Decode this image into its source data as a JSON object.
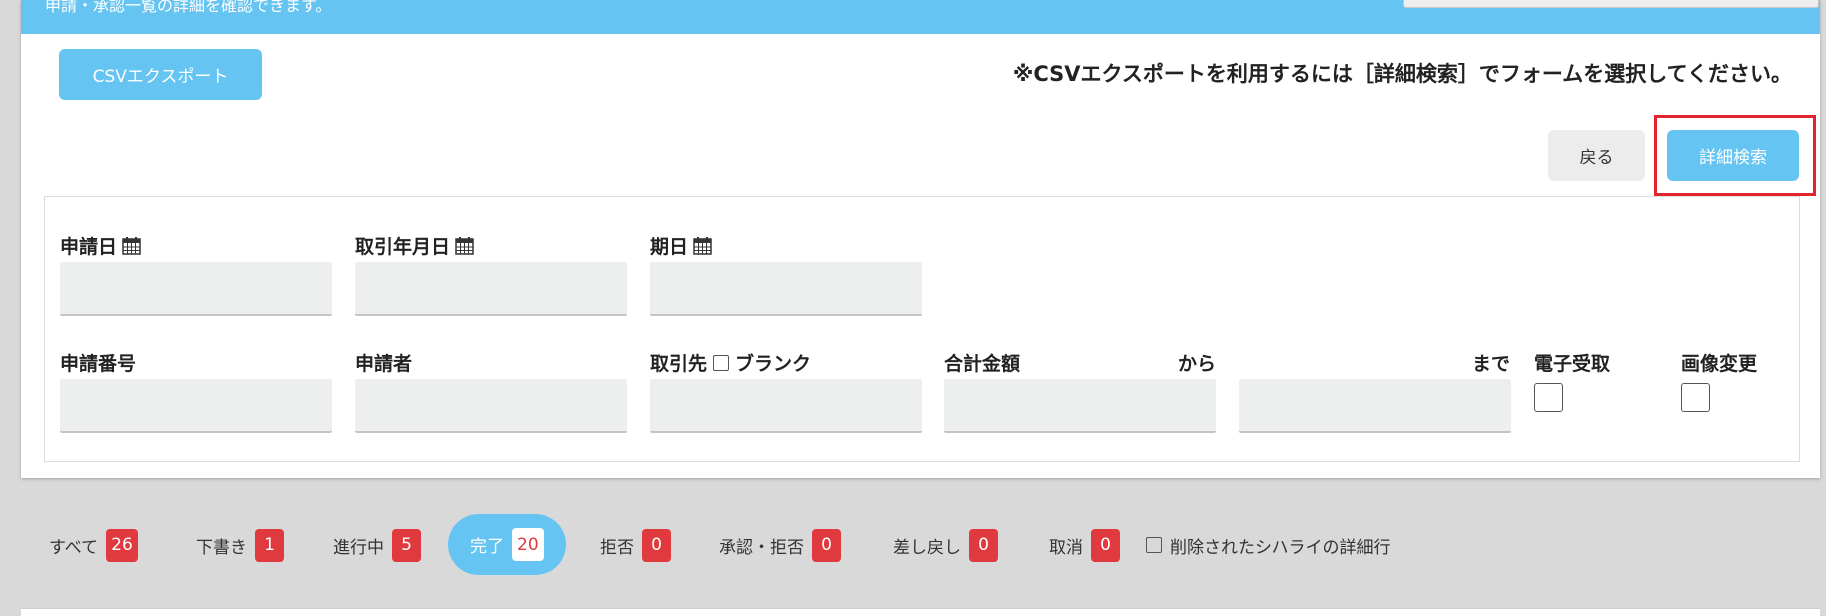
{
  "header": {
    "description": "申請・承認一覧の詳細を確認できます。"
  },
  "toolbar": {
    "csv_button": "CSVエクスポート",
    "csv_note": "※CSVエクスポートを利用するには［詳細検索］でフォームを選択してください。",
    "back_button": "戻る",
    "detail_search_button": "詳細検索"
  },
  "colors": {
    "accent": "#66c4f2",
    "badge": "#e03a3e",
    "highlight": "#e2242f"
  },
  "form": {
    "application_date": {
      "label": "申請日",
      "icon": "calendar-icon",
      "value": ""
    },
    "transaction_date": {
      "label": "取引年月日",
      "icon": "calendar-icon",
      "value": ""
    },
    "due_date": {
      "label": "期日",
      "icon": "calendar-icon",
      "value": ""
    },
    "application_number": {
      "label": "申請番号",
      "value": ""
    },
    "applicant": {
      "label": "申請者",
      "value": ""
    },
    "vendor": {
      "label": "取引先",
      "blank_label": "ブランク",
      "value": ""
    },
    "total_amount": {
      "label": "合計金額",
      "from_label": "から",
      "to_label": "まで",
      "from_value": "",
      "to_value": ""
    },
    "electronic_receipt": {
      "label": "電子受取"
    },
    "image_change": {
      "label": "画像変更"
    }
  },
  "tabs": [
    {
      "label": "すべて",
      "count": "26",
      "active": false
    },
    {
      "label": "下書き",
      "count": "1",
      "active": false
    },
    {
      "label": "進行中",
      "count": "5",
      "active": false
    },
    {
      "label": "完了",
      "count": "20",
      "active": true
    },
    {
      "label": "拒否",
      "count": "0",
      "active": false
    },
    {
      "label": "承認・拒否",
      "count": "0",
      "active": false
    },
    {
      "label": "差し戻し",
      "count": "0",
      "active": false
    },
    {
      "label": "取消",
      "count": "0",
      "active": false
    }
  ],
  "deleted_rows_label": "削除されたシハライの詳細行"
}
